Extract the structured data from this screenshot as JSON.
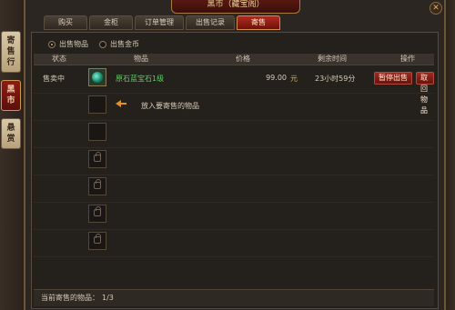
{
  "window": {
    "title": "黑市（藏宝阁）",
    "close_glyph": "✕"
  },
  "side_tabs": [
    {
      "label_top": "寄",
      "label_mid": "售",
      "label_bot": "行",
      "active": false
    },
    {
      "label_top": "黑",
      "label_mid": "市",
      "label_bot": "",
      "active": true
    },
    {
      "label_top": "悬",
      "label_mid": "赏",
      "label_bot": "",
      "active": false
    }
  ],
  "tabs": [
    {
      "label": "购买"
    },
    {
      "label": "金柜"
    },
    {
      "label": "订单管理"
    },
    {
      "label": "出售记录"
    },
    {
      "label": "寄售",
      "active": true
    }
  ],
  "radios": [
    {
      "label": "出售物品",
      "checked": true
    },
    {
      "label": "出售金币",
      "checked": false
    }
  ],
  "table": {
    "headers": [
      "状态",
      "物品",
      "价格",
      "剩余时间",
      "操作"
    ],
    "row1": {
      "status": "售卖中",
      "item_name": "原石蓝宝石1级",
      "price": "99.00",
      "currency": "元",
      "remaining": "23小时59分",
      "btn_pause": "暂停出售",
      "btn_retrieve": "取回物品"
    },
    "row2_hint": "放入要寄售的物品"
  },
  "footer": {
    "label": "当前寄售的物品：",
    "count": "1/3"
  },
  "colors": {
    "accent": "#b12b1e",
    "item_green": "#55d35c",
    "currency_gold": "#d9b12e"
  },
  "icons": {
    "gem": "sapphire-icon",
    "lock": "lock-icon",
    "arrow": "left-arrow-icon"
  }
}
